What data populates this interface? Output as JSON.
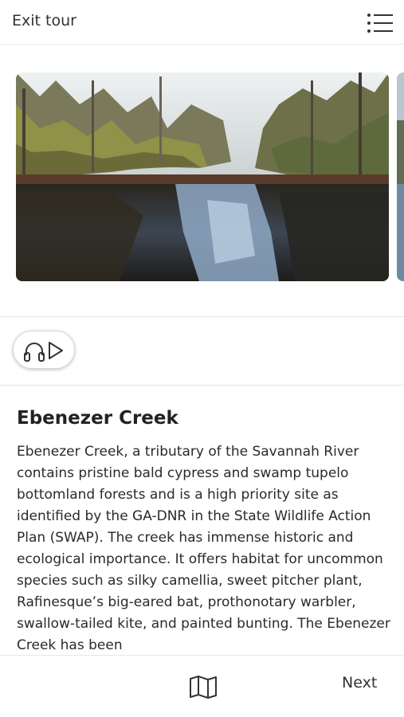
{
  "header": {
    "exit_label": "Exit tour",
    "menu_icon": "list-menu-icon"
  },
  "gallery": {
    "image_description_icon": "photo",
    "accent": "#d9d9d9"
  },
  "audio": {
    "icons": [
      "headphones-icon",
      "play-icon"
    ]
  },
  "stop": {
    "title": "Ebenezer Creek",
    "description": "Ebenezer Creek, a tributary of the Savannah River contains pristine bald cypress and swamp tupelo bottomland forests and is a high priority site as identified by the GA-DNR in the State Wildlife Action Plan (SWAP). The creek has immense historic and ecological importance. It offers habitat for uncommon species such as silky camellia, sweet pitcher plant, Rafinesque’s big-eared bat, prothonotary warbler, swallow-tailed kite, and painted bunting. The Ebenezer Creek has been"
  },
  "footer": {
    "map_icon": "map-icon",
    "next_label": "Next"
  }
}
